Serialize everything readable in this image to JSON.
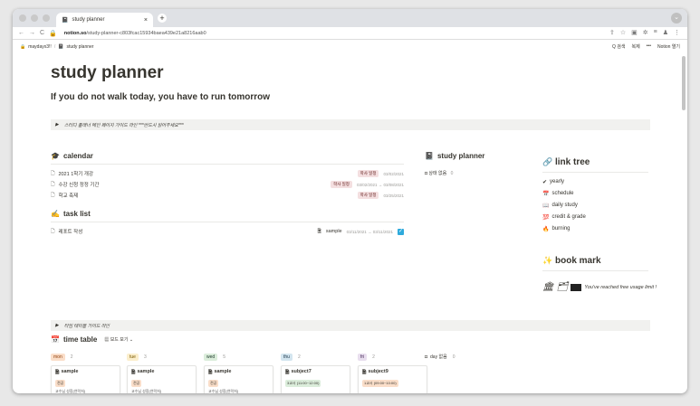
{
  "browser": {
    "tab_title": "study planner",
    "tab_close": "×",
    "new_tab": "+",
    "url_domain": "notion.so",
    "url_path": "/study-planner-c803fcac15934baea439e21a8216aab0",
    "nav": {
      "back": "←",
      "forward": "→",
      "reload": "C",
      "lock": "🔒"
    },
    "ext_icons": [
      "⇪",
      "☆",
      "▣",
      "✲",
      "≡",
      "♟",
      "⋮"
    ]
  },
  "notion_bar": {
    "workspace": "maydayx3!!",
    "separator": "/",
    "page": "study planner",
    "search": "Q 검색",
    "duplicate": "복제",
    "more": "•••",
    "open_app": "Notion 열기"
  },
  "page": {
    "title": "study planner",
    "subtitle": "If you do not walk today, you have to run tomorrow",
    "guide_toggle": "스터디 플래너 메인 페이지 가이드 라인  ***반드시 읽어주세요***",
    "table_toggle": "타임 테이블 가이드 라인"
  },
  "calendar": {
    "icon": "🎓",
    "title": "calendar",
    "rows": [
      {
        "name": "2021 1학기 개강",
        "tag": "학사 일정",
        "date": "03/02/2021"
      },
      {
        "name": "수강 신청 정정 기간",
        "tag": "학사 일정",
        "date": "03/02/2021 → 03/08/2021"
      },
      {
        "name": "학교 축제",
        "tag": "학사 일정",
        "date": "03/25/2021"
      }
    ]
  },
  "task_list": {
    "icon": "✍",
    "title": "task list",
    "rows": [
      {
        "name": "레포트 작성",
        "link": "sample",
        "date": "03/11/2021 → 03/11/2021",
        "checked": "✓"
      }
    ]
  },
  "study_planner": {
    "icon": "📓",
    "title": "study planner",
    "empty": "상태 없음",
    "empty_count": "0"
  },
  "link_tree": {
    "icon": "🔗",
    "title": "link tree",
    "items": [
      {
        "icon": "✔",
        "label": "yearly"
      },
      {
        "icon": "📅",
        "label": "schedule"
      },
      {
        "icon": "📖",
        "label": "daily study"
      },
      {
        "icon": "💯",
        "label": "credit & grade"
      },
      {
        "icon": "🔥",
        "label": "burning"
      }
    ]
  },
  "book_mark": {
    "icon": "✨",
    "title": "book mark",
    "notice": "You've reached free usage limit !"
  },
  "time_table": {
    "icon": "📅",
    "title": "time table",
    "view": "보드 보기",
    "columns": [
      {
        "day": "mon",
        "count": "2",
        "color": "#fadec9",
        "text": "#91400c"
      },
      {
        "day": "tue",
        "count": "3",
        "color": "#fbeecc",
        "text": "#7a5a00"
      },
      {
        "day": "wed",
        "count": "5",
        "color": "#dbeddb",
        "text": "#1c3829"
      },
      {
        "day": "thu",
        "count": "2",
        "color": "#d3e5ef",
        "text": "#183347"
      },
      {
        "day": "fri",
        "count": "2",
        "color": "#e8deee",
        "text": "#412454"
      }
    ],
    "no_day": "day 없음",
    "no_day_count": "0",
    "cards": [
      {
        "title": "sample",
        "tag": "전공",
        "tag_color": "#fadec9",
        "prof": "교수님 성함(연락처)"
      },
      {
        "title": "sample",
        "tag": "전공",
        "tag_color": "#fadec9",
        "prof": "교수님 성함(연락처)"
      },
      {
        "title": "sample",
        "tag": "전공",
        "tag_color": "#fadec9",
        "prof": "교수님 성함(연락처)"
      },
      {
        "title": "subject7",
        "tag": "3교시 (11:00~12:00)",
        "tag_color": "#dbeddb",
        "prof": ""
      },
      {
        "title": "subject9",
        "tag": "1교시 (09:00~10:00)",
        "tag_color": "#fadec9",
        "prof": ""
      }
    ]
  }
}
